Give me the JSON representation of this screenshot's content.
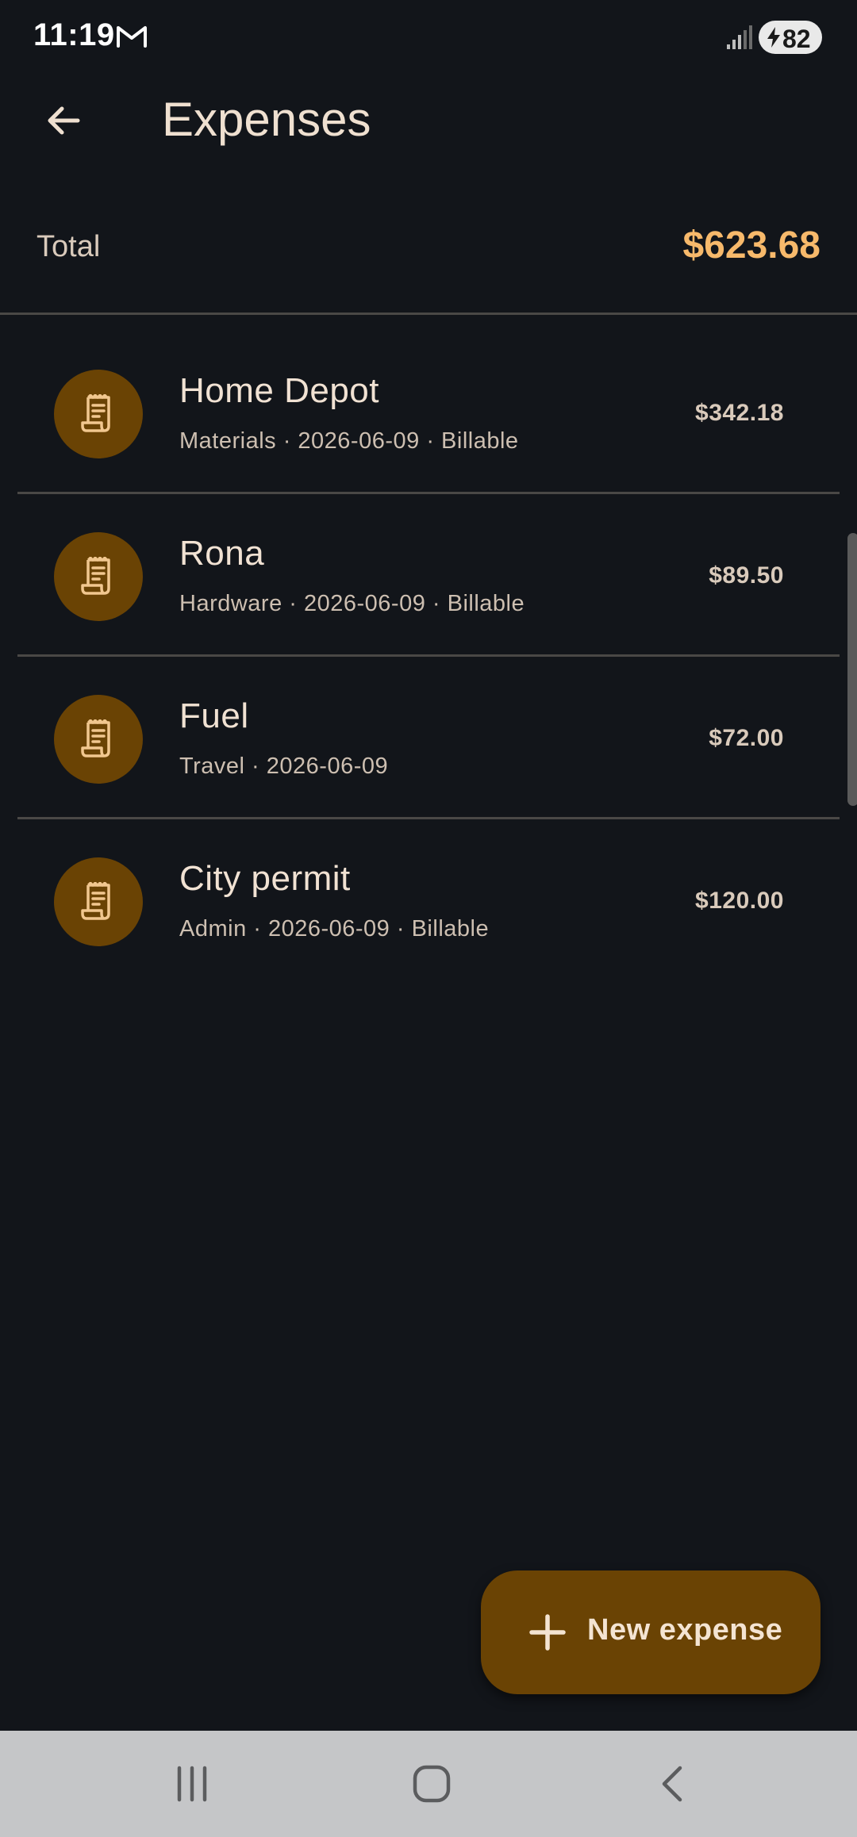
{
  "status_bar": {
    "time": "11:19",
    "battery": "82",
    "icons": [
      "gmail-icon",
      "signal-icon",
      "battery-charging-icon"
    ]
  },
  "app_bar": {
    "title": "Expenses",
    "back_icon": "arrow-left-icon"
  },
  "summary": {
    "total_label": "Total",
    "total_value": "$623.68",
    "total_color": "#f7b96b"
  },
  "expenses": [
    {
      "title": "Home Depot",
      "subtitle": "Materials · 2026-06-09 · Billable",
      "amount": "$342.18",
      "icon": "receipt-icon"
    },
    {
      "title": "Rona",
      "subtitle": "Hardware · 2026-06-09 · Billable",
      "amount": "$89.50",
      "icon": "receipt-icon"
    },
    {
      "title": "Fuel",
      "subtitle": "Travel · 2026-06-09",
      "amount": "$72.00",
      "icon": "receipt-icon"
    },
    {
      "title": "City permit",
      "subtitle": "Admin · 2026-06-09 · Billable",
      "amount": "$120.00",
      "icon": "receipt-icon"
    }
  ],
  "fab": {
    "label": "New expense",
    "icon": "plus-icon",
    "color": "#6a4304"
  },
  "nav_bar": {
    "icons": [
      "recent-apps-icon",
      "home-icon",
      "back-nav-icon"
    ]
  },
  "colors": {
    "background": "#12151a",
    "accent": "#f7b96b",
    "avatar": "#6a4304"
  }
}
